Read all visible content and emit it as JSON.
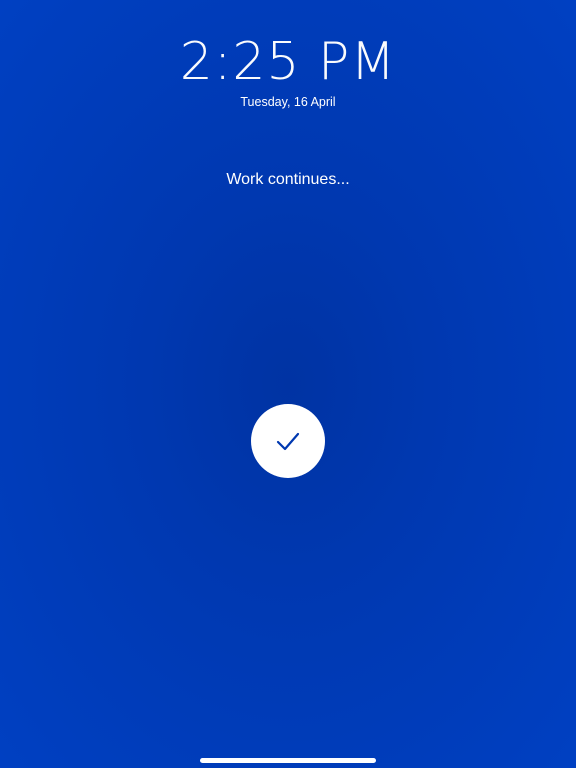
{
  "lock_screen": {
    "time": "2:25 PM",
    "date": "Tuesday, 16 April",
    "status_message": "Work continues..."
  },
  "confirm_button": {
    "icon": "checkmark-icon"
  },
  "colors": {
    "background": "#0038b0",
    "background_center": "#0033a3",
    "check_icon": "#0038b0",
    "foreground": "#ffffff"
  }
}
